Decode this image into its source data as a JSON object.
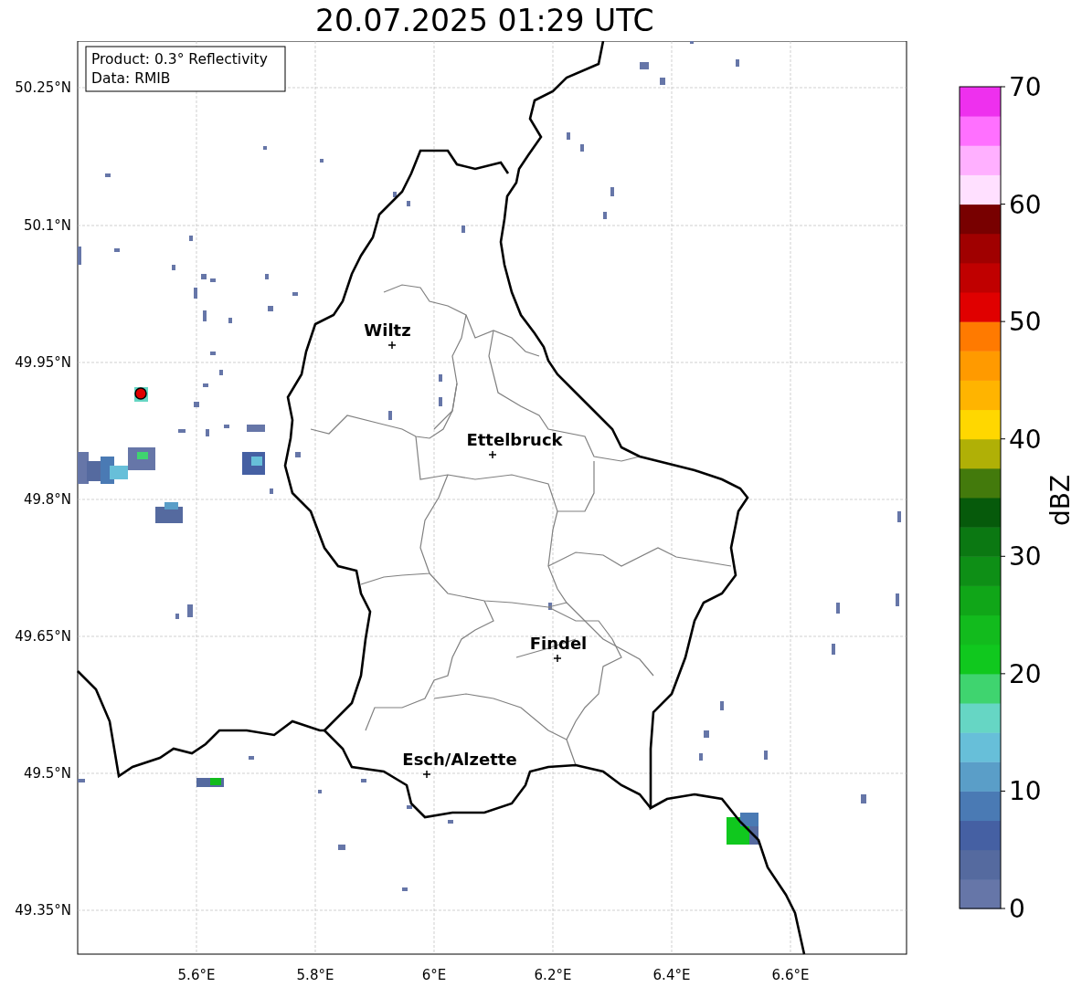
{
  "title": "20.07.2025 01:29 UTC",
  "legend": [
    "Product: 0.3° Reflectivity",
    "Data: RMIB"
  ],
  "x_ticks": [
    "5.6°E",
    "5.8°E",
    "6°E",
    "6.2°E",
    "6.4°E",
    "6.6°E"
  ],
  "y_ticks": [
    "50.25°N",
    "50.1°N",
    "49.95°N",
    "49.8°N",
    "49.65°N",
    "49.5°N",
    "49.35°N"
  ],
  "cities": [
    {
      "name": "Wiltz"
    },
    {
      "name": "Ettelbruck"
    },
    {
      "name": "Findel"
    },
    {
      "name": "Esch/Alzette"
    }
  ],
  "colorbar": {
    "label": "dBZ",
    "ticks": [
      "70",
      "60",
      "50",
      "40",
      "30",
      "20",
      "10",
      "0"
    ],
    "segments": [
      {
        "color": "#6676a8"
      },
      {
        "color": "#556a9f"
      },
      {
        "color": "#4560a3"
      },
      {
        "color": "#4a7ab4"
      },
      {
        "color": "#5a9ec8"
      },
      {
        "color": "#67bfd9"
      },
      {
        "color": "#66d6c4"
      },
      {
        "color": "#3fd46f"
      },
      {
        "color": "#10c81e"
      },
      {
        "color": "#12bb1d"
      },
      {
        "color": "#10a618"
      },
      {
        "color": "#0e8f16"
      },
      {
        "color": "#0b7812"
      },
      {
        "color": "#065a0b"
      },
      {
        "color": "#437a0c"
      },
      {
        "color": "#b0b006"
      },
      {
        "color": "#ffd700"
      },
      {
        "color": "#ffb400"
      },
      {
        "color": "#ff9a00"
      },
      {
        "color": "#ff7a00"
      },
      {
        "color": "#e00000"
      },
      {
        "color": "#c00000"
      },
      {
        "color": "#a00000"
      },
      {
        "color": "#780000"
      },
      {
        "color": "#ffe0ff"
      },
      {
        "color": "#ffb0ff"
      },
      {
        "color": "#ff70ff"
      },
      {
        "color": "#ee30ee"
      }
    ]
  }
}
